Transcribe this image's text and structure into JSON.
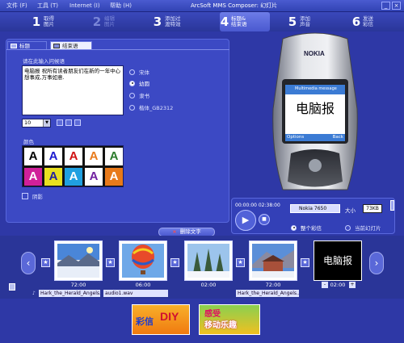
{
  "window": {
    "title": "ArcSoft MMS Composer: 幻灯片",
    "menu": [
      "文件 (F)",
      "工具 (T)",
      "Internet (I)",
      "帮助 (H)"
    ]
  },
  "steps": [
    {
      "num": "1",
      "label": "取得\n图片"
    },
    {
      "num": "2",
      "label": "编辑\n图片"
    },
    {
      "num": "3",
      "label": "添加过\n渡特效"
    },
    {
      "num": "4",
      "label": "标题&\n结束语"
    },
    {
      "num": "5",
      "label": "添加\n声音"
    },
    {
      "num": "6",
      "label": "发送\n彩信"
    }
  ],
  "tabs": {
    "title": "标题",
    "ending": "结束语"
  },
  "text_panel": {
    "prompt": "请在此输入问候语",
    "text": "电脑报 祝所有读者朋友们在新的一年中心想事成,万事如意.",
    "fonts": [
      "宋体",
      "幼圆",
      "隶书",
      "楷体_GB2312"
    ],
    "selected_font": "幼圆",
    "font_size": "10",
    "color_label": "颜色",
    "swatch_letter": "A",
    "shadow_label": "阴影"
  },
  "colors": {
    "swatches": [
      {
        "bg": "#ffffff",
        "fg": "#000000"
      },
      {
        "bg": "#ffffff",
        "fg": "#1a1acf"
      },
      {
        "bg": "#ffffff",
        "fg": "#d01010"
      },
      {
        "bg": "#ffffff",
        "fg": "#e87a1a"
      },
      {
        "bg": "#ffffff",
        "fg": "#2a7a2a"
      },
      {
        "bg": "#d0209a",
        "fg": "#ffffff"
      },
      {
        "bg": "#e8e020",
        "fg": "#2020a0"
      },
      {
        "bg": "#20a0e0",
        "fg": "#ffffff"
      },
      {
        "bg": "#ffffff",
        "fg": "#7020a0"
      },
      {
        "bg": "#e87a1a",
        "fg": "#ffffff"
      }
    ]
  },
  "phone": {
    "brand": "NOKIA",
    "screen_header": "Multimedia message",
    "screen_text": "电脑报",
    "softkey_left": "Options",
    "softkey_right": "Back"
  },
  "player": {
    "time": "00:00:00 02:38:00",
    "device": "Nokia 7650",
    "size_label": "大小",
    "size_value": "73KB",
    "options": [
      "整个彩信",
      "当前幻灯片"
    ]
  },
  "delete_button": "删除文字",
  "timeline": {
    "frames": [
      {
        "time": "72:00"
      },
      {
        "time": "06:00"
      },
      {
        "time": "02:00"
      },
      {
        "time": "72:00"
      },
      {
        "time": "02:00",
        "text": "电脑报"
      }
    ],
    "audio": [
      "Hark_the_Herald_Angels...",
      "audio1.wav",
      "Hark_the_Herald_Angels..."
    ]
  },
  "banners": [
    {
      "line1": "彩信",
      "line2": "DIY"
    },
    {
      "line1": "感受",
      "line2": "移动乐趣"
    }
  ]
}
